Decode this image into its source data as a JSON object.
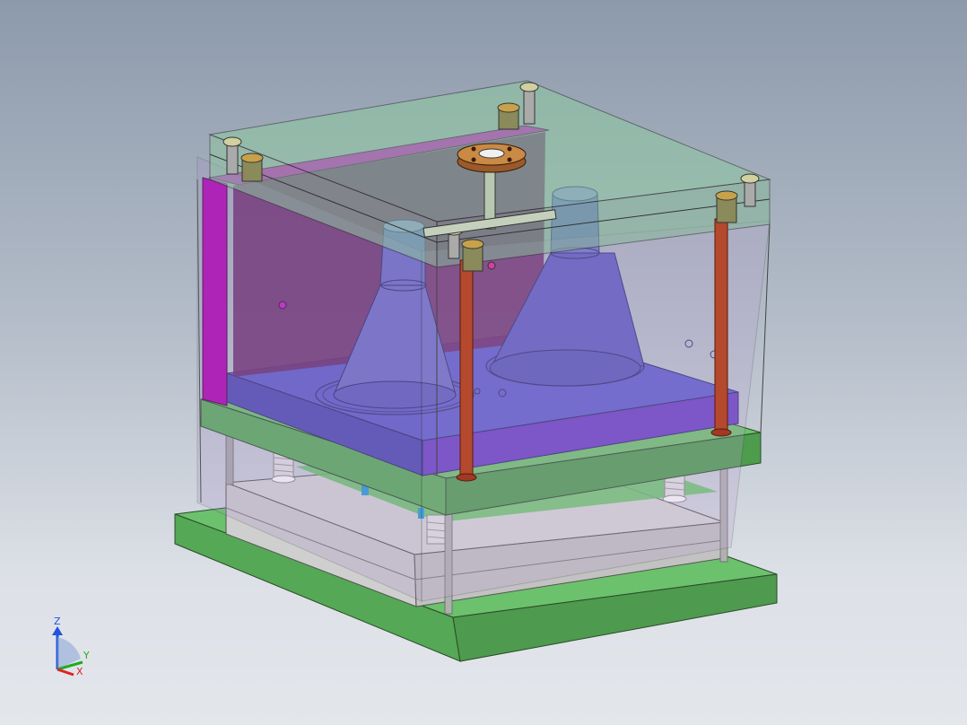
{
  "viewport": {
    "model": "injection-mold-assembly",
    "colors": {
      "background_top": "#8d9aab",
      "background_bottom": "#e3e6eb",
      "top_clamp_plate": "#9ec9a0",
      "cavity_plate_side": "#b000b0",
      "core_insert": "#5a58c8",
      "cores": "#5d58c0",
      "support_plates": "#5fb85f",
      "spacer_blocks": "#d0d0d0",
      "guide_pins": "#b04a30",
      "springs": "#dcdcdc"
    }
  },
  "triad": {
    "z_label": "Z",
    "y_label": "Y",
    "x_label": "X",
    "z_color": "#2255dd",
    "y_color": "#22aa22",
    "x_color": "#dd2222"
  }
}
